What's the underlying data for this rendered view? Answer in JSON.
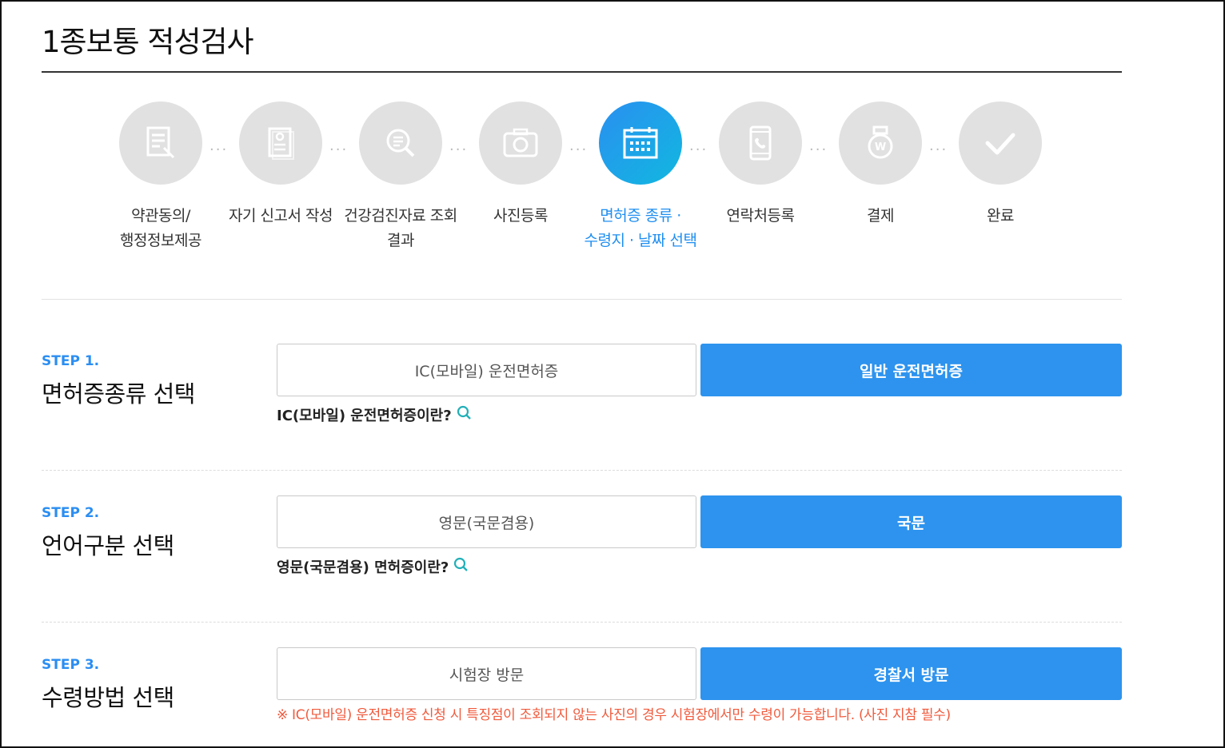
{
  "page": {
    "title": "1종보통 적성검사"
  },
  "steps": [
    {
      "label": "약관동의/\n행정정보제공",
      "icon": "document-pen-icon",
      "active": false
    },
    {
      "label": "자기 신고서 작성",
      "icon": "id-document-icon",
      "active": false
    },
    {
      "label": "건강검진자료 조회\n결과",
      "icon": "search-document-icon",
      "active": false
    },
    {
      "label": "사진등록",
      "icon": "camera-icon",
      "active": false
    },
    {
      "label": "면허증 종류 ·\n수령지 · 날짜 선택",
      "icon": "calendar-icon",
      "active": true
    },
    {
      "label": "연락처등록",
      "icon": "phone-icon",
      "active": false
    },
    {
      "label": "결제",
      "icon": "payment-bag-icon",
      "active": false
    },
    {
      "label": "완료",
      "icon": "check-icon",
      "active": false
    }
  ],
  "step1": {
    "no": "STEP 1.",
    "title": "면허증종류 선택",
    "option_off": "IC(모바일) 운전면허증",
    "option_on": "일반 운전면허증",
    "help": "IC(모바일) 운전면허증이란?"
  },
  "step2": {
    "no": "STEP 2.",
    "title": "언어구분 선택",
    "option_off": "영문(국문겸용)",
    "option_on": "국문",
    "help": "영문(국문겸용) 면허증이란?"
  },
  "step3": {
    "no": "STEP 3.",
    "title": "수령방법 선택",
    "option_off": "시험장 방문",
    "option_on": "경찰서 방문",
    "notice": "※ IC(모바일) 운전면허증 신청 시 특징점이 조회되지 않는 사진의 경우 시험장에서만 수령이 가능합니다. (사진 지참 필수)"
  },
  "colors": {
    "accent": "#2d93ee",
    "step_label": "#2b8ef2",
    "notice": "#f05a3c",
    "inactive_circle": "#e1e1e1"
  }
}
